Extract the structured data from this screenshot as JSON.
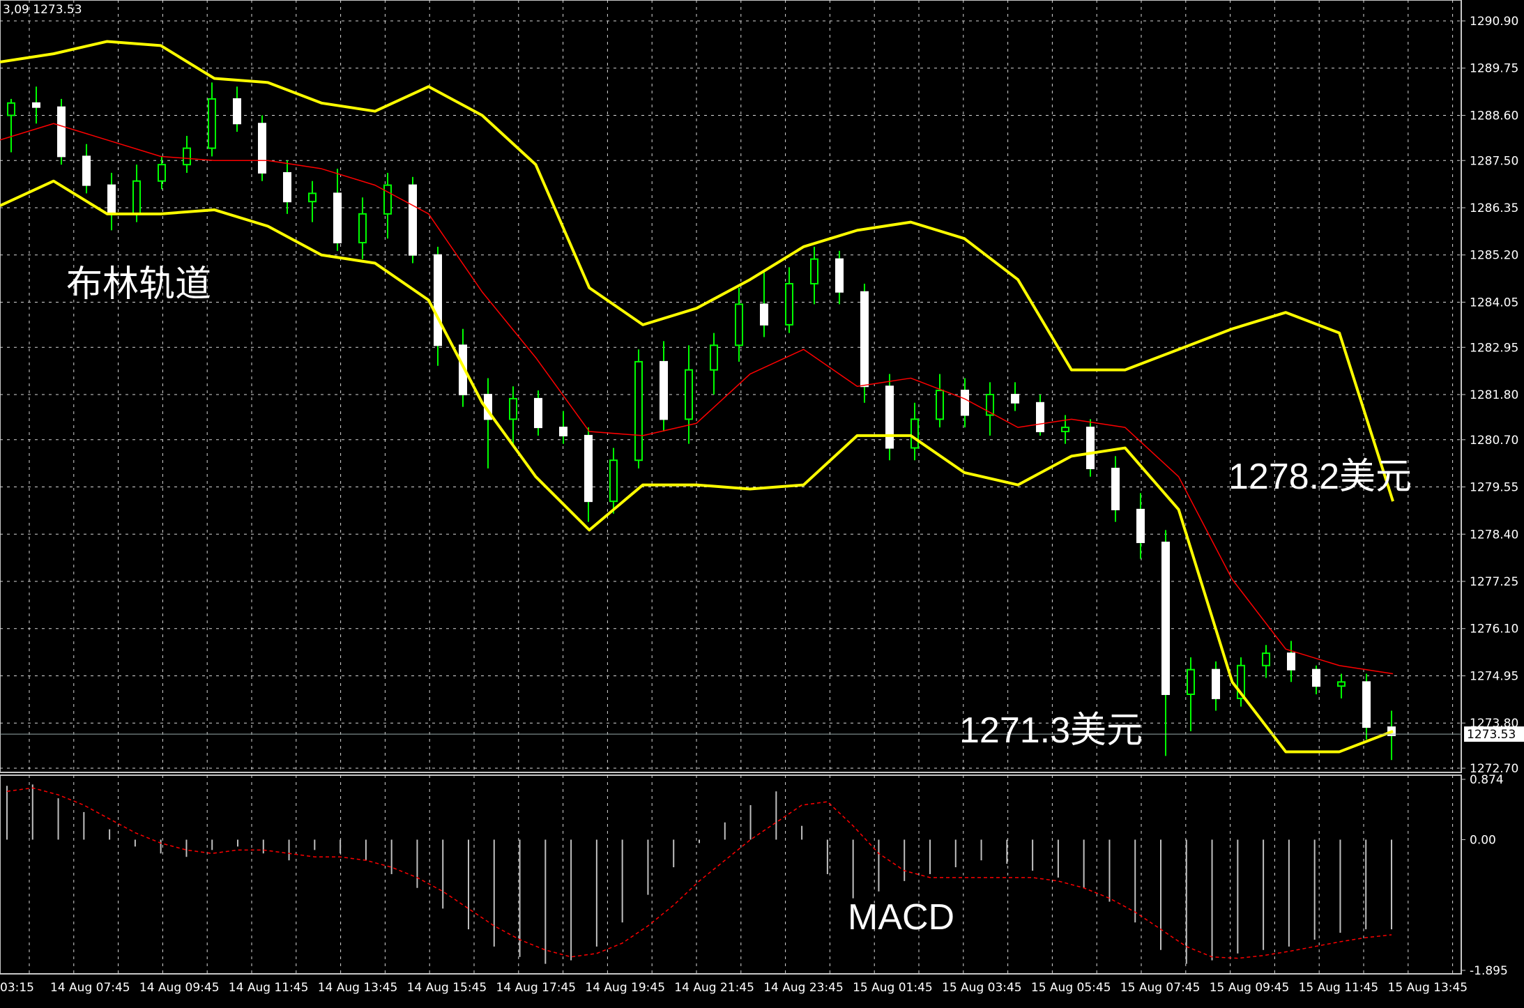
{
  "header_text": "3,09 1273.53",
  "annotations": {
    "bollinger_label": "布林轨道",
    "upper_value_label": "1278.2美元",
    "lower_value_label": "1271.3美元",
    "macd_label": "MACD"
  },
  "colors": {
    "background": "#000000",
    "grid": "#d9d9d9",
    "bull_candle": "#00ff00",
    "bear_candle": "#ffffff",
    "bollinger_band": "#ffff00",
    "moving_average": "#ff0000",
    "macd_histogram": "#c0c0c0",
    "macd_signal": "#ff0000",
    "text": "#ffffff"
  },
  "chart_data": [
    {
      "type": "candlestick",
      "title": "",
      "price_ticks": [
        "1290.90",
        "1289.75",
        "1288.60",
        "1287.50",
        "1286.35",
        "1285.20",
        "1284.05",
        "1282.95",
        "1281.80",
        "1280.70",
        "1279.55",
        "1278.40",
        "1277.25",
        "1276.10",
        "1274.95",
        "1273.80",
        "1272.70"
      ],
      "ylim": [
        1272.7,
        1290.9
      ],
      "current_price": "1273.53",
      "x_ticks": [
        "03:15",
        "14 Aug 07:45",
        "14 Aug 09:45",
        "14 Aug 11:45",
        "14 Aug 13:45",
        "14 Aug 15:45",
        "14 Aug 17:45",
        "14 Aug 19:45",
        "14 Aug 21:45",
        "14 Aug 23:45",
        "15 Aug 01:45",
        "15 Aug 03:45",
        "15 Aug 05:45",
        "15 Aug 07:45",
        "15 Aug 09:45",
        "15 Aug 11:45",
        "15 Aug 13:45"
      ],
      "indicators": [
        "Bollinger Bands",
        "Moving Average"
      ],
      "upper_band": [
        1289.9,
        1290.1,
        1290.4,
        1290.3,
        1289.5,
        1289.4,
        1288.9,
        1288.7,
        1289.3,
        1288.6,
        1287.4,
        1284.4,
        1283.5,
        1283.9,
        1284.6,
        1285.4,
        1285.8,
        1286.0,
        1285.6,
        1284.6,
        1282.4,
        1282.4,
        1282.9,
        1283.4,
        1283.8,
        1283.3,
        1279.2
      ],
      "lower_band": [
        1286.4,
        1287.0,
        1286.2,
        1286.2,
        1286.3,
        1285.9,
        1285.2,
        1285.0,
        1284.1,
        1281.6,
        1279.8,
        1278.5,
        1279.6,
        1279.6,
        1279.5,
        1279.6,
        1280.8,
        1280.8,
        1279.9,
        1279.6,
        1280.3,
        1280.5,
        1279.0,
        1274.8,
        1273.1,
        1273.1,
        1273.6
      ],
      "moving_average": [
        1288.0,
        1288.4,
        1288.0,
        1287.6,
        1287.5,
        1287.5,
        1287.3,
        1286.9,
        1286.2,
        1284.3,
        1282.7,
        1280.9,
        1280.8,
        1281.1,
        1282.3,
        1282.9,
        1282.0,
        1282.2,
        1281.7,
        1281.0,
        1281.2,
        1281.0,
        1279.8,
        1277.3,
        1275.6,
        1275.2,
        1275.0
      ],
      "candles": [
        {
          "o": 1288.6,
          "h": 1289.0,
          "l": 1287.7,
          "c": 1288.9
        },
        {
          "o": 1288.9,
          "h": 1289.3,
          "l": 1288.4,
          "c": 1288.8
        },
        {
          "o": 1288.8,
          "h": 1289.0,
          "l": 1287.4,
          "c": 1287.6
        },
        {
          "o": 1287.6,
          "h": 1287.9,
          "l": 1286.7,
          "c": 1286.9
        },
        {
          "o": 1286.9,
          "h": 1287.2,
          "l": 1285.8,
          "c": 1286.2
        },
        {
          "o": 1286.2,
          "h": 1287.4,
          "l": 1286.0,
          "c": 1287.0
        },
        {
          "o": 1287.0,
          "h": 1287.6,
          "l": 1286.8,
          "c": 1287.4
        },
        {
          "o": 1287.4,
          "h": 1288.1,
          "l": 1287.2,
          "c": 1287.8
        },
        {
          "o": 1287.8,
          "h": 1289.4,
          "l": 1287.6,
          "c": 1289.0
        },
        {
          "o": 1289.0,
          "h": 1289.3,
          "l": 1288.2,
          "c": 1288.4
        },
        {
          "o": 1288.4,
          "h": 1288.6,
          "l": 1287.0,
          "c": 1287.2
        },
        {
          "o": 1287.2,
          "h": 1287.5,
          "l": 1286.2,
          "c": 1286.5
        },
        {
          "o": 1286.5,
          "h": 1287.0,
          "l": 1286.0,
          "c": 1286.7
        },
        {
          "o": 1286.7,
          "h": 1287.3,
          "l": 1285.3,
          "c": 1285.5
        },
        {
          "o": 1285.5,
          "h": 1286.6,
          "l": 1285.1,
          "c": 1286.2
        },
        {
          "o": 1286.2,
          "h": 1287.2,
          "l": 1285.6,
          "c": 1286.9
        },
        {
          "o": 1286.9,
          "h": 1287.1,
          "l": 1285.0,
          "c": 1285.2
        },
        {
          "o": 1285.2,
          "h": 1285.4,
          "l": 1282.5,
          "c": 1283.0
        },
        {
          "o": 1283.0,
          "h": 1283.4,
          "l": 1281.5,
          "c": 1281.8
        },
        {
          "o": 1281.8,
          "h": 1282.2,
          "l": 1280.0,
          "c": 1281.2
        },
        {
          "o": 1281.2,
          "h": 1282.0,
          "l": 1280.6,
          "c": 1281.7
        },
        {
          "o": 1281.7,
          "h": 1281.9,
          "l": 1280.8,
          "c": 1281.0
        },
        {
          "o": 1281.0,
          "h": 1281.4,
          "l": 1280.6,
          "c": 1280.8
        },
        {
          "o": 1280.8,
          "h": 1281.0,
          "l": 1278.7,
          "c": 1279.2
        },
        {
          "o": 1279.2,
          "h": 1280.5,
          "l": 1278.9,
          "c": 1280.2
        },
        {
          "o": 1280.2,
          "h": 1282.9,
          "l": 1280.0,
          "c": 1282.6
        },
        {
          "o": 1282.6,
          "h": 1283.1,
          "l": 1280.9,
          "c": 1281.2
        },
        {
          "o": 1281.2,
          "h": 1283.0,
          "l": 1280.6,
          "c": 1282.4
        },
        {
          "o": 1282.4,
          "h": 1283.3,
          "l": 1281.8,
          "c": 1283.0
        },
        {
          "o": 1283.0,
          "h": 1284.4,
          "l": 1282.6,
          "c": 1284.0
        },
        {
          "o": 1284.0,
          "h": 1284.8,
          "l": 1283.2,
          "c": 1283.5
        },
        {
          "o": 1283.5,
          "h": 1284.9,
          "l": 1283.3,
          "c": 1284.5
        },
        {
          "o": 1284.5,
          "h": 1285.4,
          "l": 1284.0,
          "c": 1285.1
        },
        {
          "o": 1285.1,
          "h": 1285.3,
          "l": 1284.0,
          "c": 1284.3
        },
        {
          "o": 1284.3,
          "h": 1284.5,
          "l": 1281.6,
          "c": 1282.0
        },
        {
          "o": 1282.0,
          "h": 1282.3,
          "l": 1280.2,
          "c": 1280.5
        },
        {
          "o": 1280.5,
          "h": 1281.6,
          "l": 1280.2,
          "c": 1281.2
        },
        {
          "o": 1281.2,
          "h": 1282.3,
          "l": 1281.0,
          "c": 1281.9
        },
        {
          "o": 1281.9,
          "h": 1282.2,
          "l": 1281.0,
          "c": 1281.3
        },
        {
          "o": 1281.3,
          "h": 1282.1,
          "l": 1280.8,
          "c": 1281.8
        },
        {
          "o": 1281.8,
          "h": 1282.1,
          "l": 1281.4,
          "c": 1281.6
        },
        {
          "o": 1281.6,
          "h": 1281.8,
          "l": 1280.8,
          "c": 1280.9
        },
        {
          "o": 1280.9,
          "h": 1281.3,
          "l": 1280.6,
          "c": 1281.0
        },
        {
          "o": 1281.0,
          "h": 1281.2,
          "l": 1279.8,
          "c": 1280.0
        },
        {
          "o": 1280.0,
          "h": 1280.3,
          "l": 1278.7,
          "c": 1279.0
        },
        {
          "o": 1279.0,
          "h": 1279.4,
          "l": 1277.8,
          "c": 1278.2
        },
        {
          "o": 1278.2,
          "h": 1278.5,
          "l": 1273.0,
          "c": 1274.5
        },
        {
          "o": 1274.5,
          "h": 1275.4,
          "l": 1273.6,
          "c": 1275.1
        },
        {
          "o": 1275.1,
          "h": 1275.3,
          "l": 1274.1,
          "c": 1274.4
        },
        {
          "o": 1274.4,
          "h": 1275.4,
          "l": 1274.2,
          "c": 1275.2
        },
        {
          "o": 1275.2,
          "h": 1275.7,
          "l": 1274.9,
          "c": 1275.5
        },
        {
          "o": 1275.5,
          "h": 1275.8,
          "l": 1274.8,
          "c": 1275.1
        },
        {
          "o": 1275.1,
          "h": 1275.2,
          "l": 1274.5,
          "c": 1274.7
        },
        {
          "o": 1274.7,
          "h": 1275.0,
          "l": 1274.4,
          "c": 1274.8
        },
        {
          "o": 1274.8,
          "h": 1275.0,
          "l": 1273.4,
          "c": 1273.7
        },
        {
          "o": 1273.7,
          "h": 1274.1,
          "l": 1272.9,
          "c": 1273.5
        }
      ]
    },
    {
      "type": "bar",
      "title": "",
      "indicator": "MACD",
      "ticks": [
        "0.874",
        "0.00",
        "-1.895"
      ],
      "ylim": [
        -1.895,
        0.874
      ],
      "histogram": [
        0.78,
        0.8,
        0.6,
        0.4,
        0.15,
        -0.1,
        -0.2,
        -0.25,
        -0.15,
        -0.1,
        -0.2,
        -0.3,
        -0.15,
        -0.2,
        -0.3,
        -0.5,
        -0.7,
        -1.0,
        -1.3,
        -1.55,
        -1.7,
        -1.8,
        -1.75,
        -1.55,
        -1.2,
        -0.8,
        -0.4,
        -0.05,
        0.25,
        0.5,
        0.7,
        0.2,
        -0.5,
        -0.85,
        -0.75,
        -0.6,
        -0.5,
        -0.4,
        -0.3,
        -0.35,
        -0.45,
        -0.55,
        -0.7,
        -0.9,
        -1.2,
        -1.6,
        -1.8,
        -1.75,
        -1.65,
        -1.6,
        -1.55,
        -1.45,
        -1.35,
        -1.3,
        -1.3
      ],
      "signal": [
        0.7,
        0.75,
        0.65,
        0.5,
        0.3,
        0.1,
        -0.05,
        -0.15,
        -0.2,
        -0.15,
        -0.15,
        -0.2,
        -0.25,
        -0.25,
        -0.3,
        -0.4,
        -0.55,
        -0.75,
        -1.0,
        -1.25,
        -1.45,
        -1.6,
        -1.7,
        -1.65,
        -1.5,
        -1.25,
        -0.95,
        -0.6,
        -0.3,
        0.0,
        0.25,
        0.5,
        0.55,
        0.2,
        -0.2,
        -0.45,
        -0.55,
        -0.55,
        -0.55,
        -0.55,
        -0.55,
        -0.6,
        -0.7,
        -0.85,
        -1.05,
        -1.3,
        -1.55,
        -1.7,
        -1.72,
        -1.68,
        -1.62,
        -1.55,
        -1.48,
        -1.42,
        -1.38
      ]
    }
  ]
}
